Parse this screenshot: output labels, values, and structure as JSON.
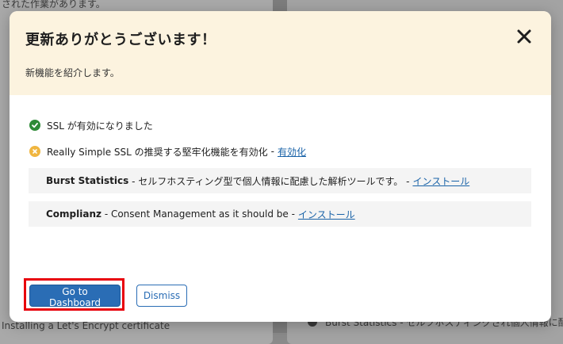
{
  "background": {
    "fragments": [
      "された作業があります。",
      "Installing a Let's Encrypt certificate",
      "Burst Statistics - セルフホスティングされ個人情報に配"
    ]
  },
  "modal": {
    "title": "更新ありがとうございます！",
    "subtitle": "新機能を紹介します。",
    "close_icon": "close-icon",
    "items": [
      {
        "icon": "check-circle-icon",
        "status_color": "#2e8a37",
        "text": "SSL が有効になりました"
      },
      {
        "icon": "warning-circle-icon",
        "status_color": "#f0b640",
        "text": "Really Simple SSL の推奨する堅牢化機能を有効化",
        "separator": "-",
        "link": "有効化"
      }
    ],
    "plugins": [
      {
        "name": "Burst Statistics",
        "description": " - セルフホスティング型で個人情報に配慮した解析ツールです。 -",
        "link": "インストール"
      },
      {
        "name": "Complianz",
        "description": " - Consent Management as it should be -",
        "link": "インストール"
      }
    ],
    "buttons": {
      "primary": "Go to Dashboard",
      "secondary": "Dismiss"
    }
  },
  "colors": {
    "header_bg": "#fcf3df",
    "primary": "#2a6db5",
    "link": "#1a63a8",
    "highlight": "#e8000b"
  }
}
